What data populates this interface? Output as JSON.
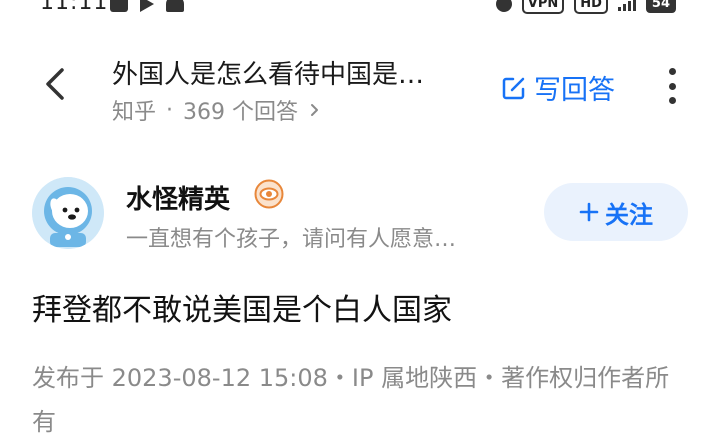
{
  "status_bar": {
    "time": "11:11",
    "vpn": "VPN",
    "hd": "HD",
    "battery": "54"
  },
  "header": {
    "question_title": "外国人是怎么看待中国是…",
    "source": "知乎",
    "separator": "·",
    "answer_count": "369 个回答",
    "answer_button": "写回答"
  },
  "author": {
    "name": "水怪精英",
    "bio": "一直想有个孩子，请问有人愿意…",
    "follow_button": "关注"
  },
  "answer": {
    "text": "拜登都不敢说美国是个白人国家",
    "publish_info": "发布于 2023-08-12 15:08・IP 属地陕西・著作权归作者所有"
  },
  "colors": {
    "accent": "#1772f6",
    "muted": "#8a8a8a",
    "follow_bg": "#eaf2fd",
    "badge": "#e8873a"
  },
  "icons": {
    "back": "chevron-left-icon",
    "answer": "edit-icon",
    "more": "more-vertical-icon",
    "badge": "eye-badge-icon",
    "follow": "plus-icon",
    "meta": "chevron-right-icon"
  }
}
